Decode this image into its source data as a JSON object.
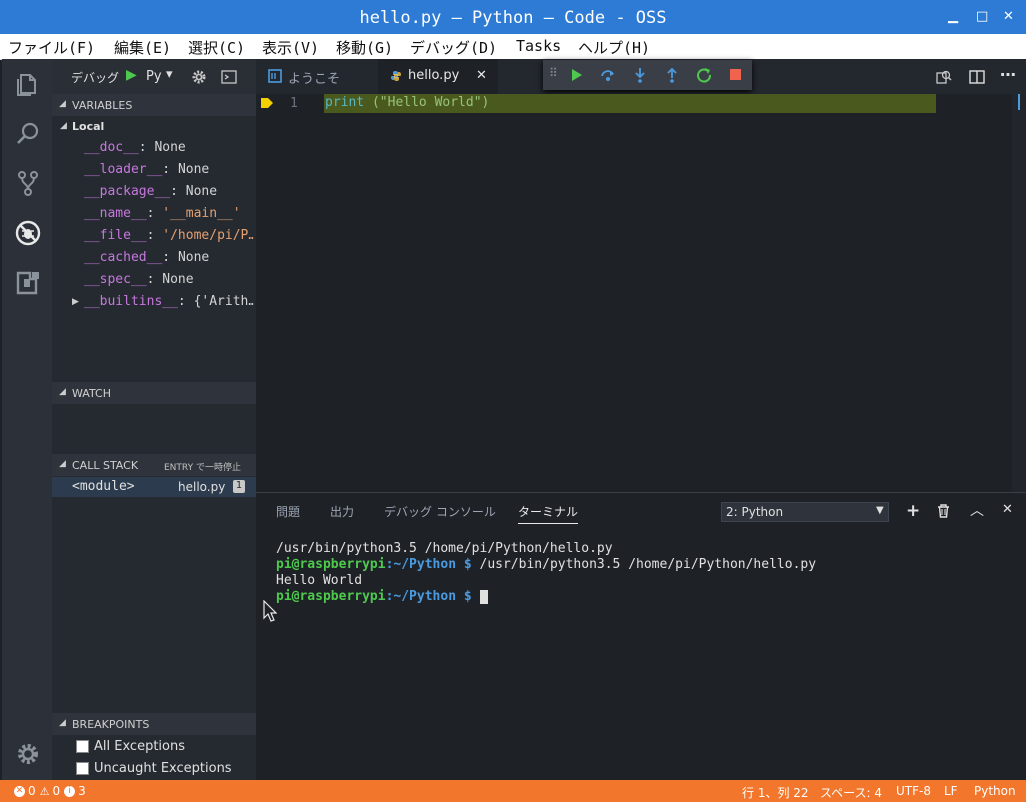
{
  "window": {
    "title": "hello.py — Python — Code - OSS",
    "min": "▁",
    "max": "□",
    "close": "✕"
  },
  "menu": [
    "ファイル(F)",
    "編集(E)",
    "選択(C)",
    "表示(V)",
    "移動(G)",
    "デバッグ(D)",
    "Tasks",
    "ヘルプ(H)"
  ],
  "debug": {
    "label": "デバッグ",
    "config": "Py",
    "play": "▶",
    "dropdown": "▾"
  },
  "tabs": [
    {
      "label": "ようこそ"
    },
    {
      "label": "hello.py",
      "close": "✕"
    }
  ],
  "variables": {
    "header": "VARIABLES",
    "scope": "Local",
    "items": [
      {
        "name": "__doc__",
        "value": "None"
      },
      {
        "name": "__loader__",
        "value": "None"
      },
      {
        "name": "__package__",
        "value": "None"
      },
      {
        "name": "__name__",
        "value": "'__main__'"
      },
      {
        "name": "__file__",
        "value": "'/home/pi/P…"
      },
      {
        "name": "__cached__",
        "value": "None"
      },
      {
        "name": "__spec__",
        "value": "None"
      },
      {
        "name": "__builtins__",
        "value": "{'Arith…"
      }
    ]
  },
  "watch": {
    "header": "WATCH"
  },
  "callstack": {
    "header": "CALL STACK",
    "status": "ENTRY で一時停止",
    "frame": "<module>",
    "file": "hello.py",
    "line": "1"
  },
  "breakpoints": {
    "header": "BREAKPOINTS",
    "items": [
      "All Exceptions",
      "Uncaught Exceptions"
    ]
  },
  "editor": {
    "line_number": "1",
    "code_keyword": "print",
    "code_rest": " (\"Hello World\")"
  },
  "panel": {
    "tabs": [
      "問題",
      "出力",
      "デバッグ コンソール",
      "ターミナル"
    ],
    "terminal_select": "2: Python",
    "lines": [
      {
        "plain": "/usr/bin/python3.5 /home/pi/Python/hello.py"
      },
      {
        "user": "pi@raspberrypi",
        "path": ":~/Python $",
        "cmd": " /usr/bin/python3.5 /home/pi/Python/hello.py"
      },
      {
        "plain": "Hello World"
      },
      {
        "user": "pi@raspberrypi",
        "path": ":~/Python $",
        "cmd": ""
      }
    ]
  },
  "status": {
    "errors": "0",
    "warnings": "0",
    "info": "3",
    "position": "行 1、列 22",
    "spaces": "スペース: 4",
    "encoding": "UTF-8",
    "eol": "LF",
    "language": "Python"
  },
  "colors": {
    "titlebar": "#2e7bd6",
    "statusbar": "#f2762b",
    "accent_green": "#4ec94e",
    "breakpoint_yellow": "#f5d100"
  }
}
